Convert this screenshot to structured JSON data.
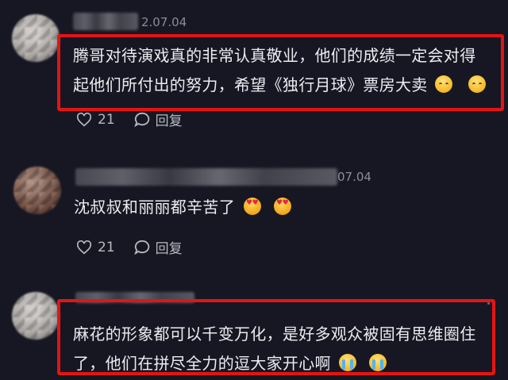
{
  "comments": [
    {
      "date": "2.07.04",
      "text_line1": "腾哥对待演戏真的非常认真敬业，他们的成绩一定会对得",
      "text_line2": "起他们所付出的努力，希望《独行月球》票房大卖",
      "emoji": "sweat-smile-emoji",
      "likes": "21",
      "reply_label": "回复"
    },
    {
      "date": "07.04",
      "text_line1": "沈叔叔和丽丽都辛苦了",
      "emoji": "heart-eyes-emoji",
      "likes": "21",
      "reply_label": "回复"
    },
    {
      "text_line1": "麻花的形象都可以千变万化，是好多观众被固有思维圈住",
      "text_line2": "了，他们在拼尽全力的逗大家开心啊",
      "emoji": "crying-emoji"
    }
  ],
  "colors": {
    "background": "#161722",
    "highlight_border": "#e41414",
    "text": "#ececf1",
    "muted": "#8b8c95"
  },
  "icons": {
    "like": "heart-outline-icon",
    "reply": "speech-bubble-icon"
  }
}
